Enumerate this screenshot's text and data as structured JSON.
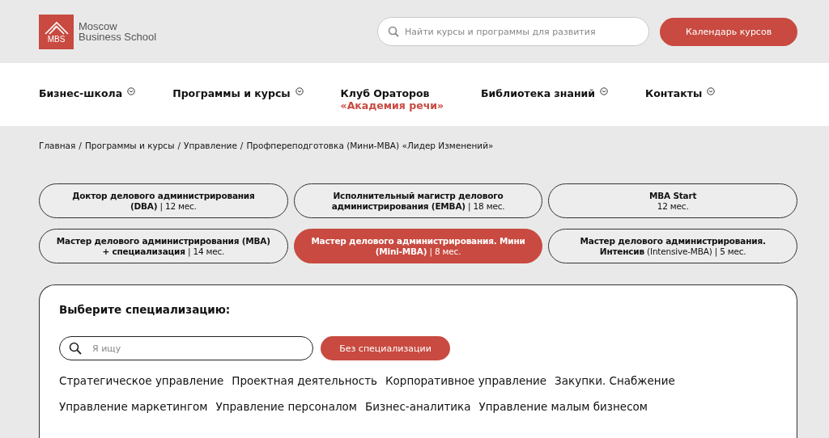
{
  "logo": {
    "mark": "MBS",
    "name_line1": "Moscow",
    "name_line2": "Business School"
  },
  "search": {
    "placeholder": "Найти курсы и программы для развития"
  },
  "calendar_button": "Календарь курсов",
  "nav": [
    {
      "label": "Бизнес-школа",
      "dropdown": true
    },
    {
      "label": "Программы и курсы",
      "dropdown": true
    },
    {
      "label": "Клуб Ораторов",
      "sublabel": "«Академия речи»",
      "dropdown": false
    },
    {
      "label": "Библиотека знаний",
      "dropdown": true
    },
    {
      "label": "Контакты",
      "dropdown": true
    }
  ],
  "breadcrumb_separator": "/",
  "breadcrumbs": [
    "Главная",
    "Программы и курсы",
    "Управление",
    "Профпереподготовка (Мини-MBA) «Лидер Изменений»"
  ],
  "programs": [
    {
      "lines": [
        "**Доктор делового администрирования**",
        "**(DBA)** | 12 мес."
      ],
      "selected": false
    },
    {
      "lines": [
        "**Исполнительный магистр делового**",
        "**администрирования (EMBA)** | 18 мес."
      ],
      "selected": false
    },
    {
      "lines": [
        "**MBA Start**",
        "12 мес."
      ],
      "selected": false
    },
    {
      "lines": [
        "**Мастер делового администрирования (MBA)**",
        "**+ специализация** | 14 мес."
      ],
      "selected": false
    },
    {
      "lines": [
        "**Мастер делового администрирования. Мини**",
        "**(Mini-MBA)** | 8 мес."
      ],
      "selected": true
    },
    {
      "lines": [
        "**Мастер делового администрирования.**",
        "**Интенсив** (Intensive-MBA) | 5 мес."
      ],
      "selected": false
    }
  ],
  "specialization": {
    "title": "Выберите специализацию:",
    "search_placeholder": "Я ищу",
    "no_spec_button": "Без специализации",
    "rows": [
      [
        "Стратегическое управление",
        "Проектная деятельность",
        "Корпоративное управление",
        "Закупки. Снабжение"
      ],
      [
        "Управление маркетингом",
        "Управление персоналом",
        "Бизнес-аналитика",
        "Управление малым бизнесом"
      ]
    ]
  }
}
